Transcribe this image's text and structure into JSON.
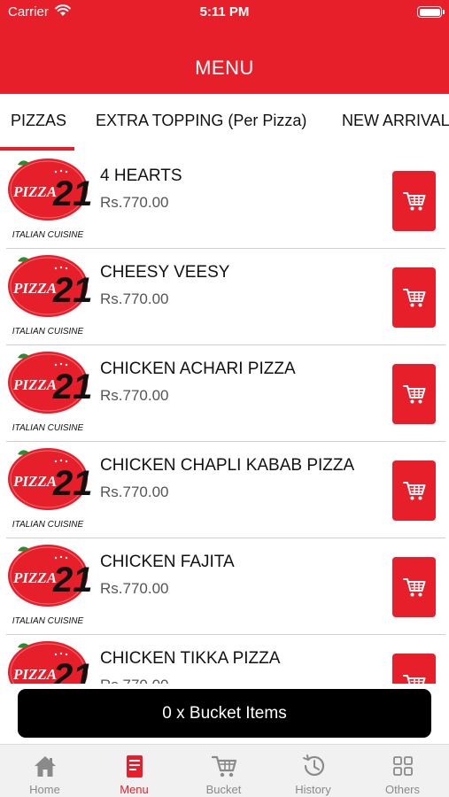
{
  "status_bar": {
    "carrier": "Carrier",
    "time": "5:11 PM"
  },
  "header": {
    "title": "MENU"
  },
  "tabs": [
    {
      "label": "PIZZAS",
      "active": true
    },
    {
      "label": "EXTRA TOPPING (Per Pizza)",
      "active": false
    },
    {
      "label": "NEW ARRIVAL",
      "active": false
    }
  ],
  "logo": {
    "brand": "PIZZA",
    "number": "21",
    "caption": "ITALIAN CUISINE"
  },
  "menu_items": [
    {
      "name": "4 HEARTS",
      "price": "Rs.770.00"
    },
    {
      "name": "CHEESY VEESY",
      "price": "Rs.770.00"
    },
    {
      "name": "CHICKEN ACHARI PIZZA",
      "price": "Rs.770.00"
    },
    {
      "name": "CHICKEN CHAPLI KABAB PIZZA",
      "price": "Rs.770.00"
    },
    {
      "name": "CHICKEN FAJITA",
      "price": "Rs.770.00"
    },
    {
      "name": "CHICKEN TIKKA PIZZA",
      "price": "Rs.770.00"
    }
  ],
  "bucket_bar": {
    "label": "0 x Bucket Items"
  },
  "bottom_nav": [
    {
      "label": "Home",
      "icon": "home-icon",
      "active": false
    },
    {
      "label": "Menu",
      "icon": "menu-icon",
      "active": true
    },
    {
      "label": "Bucket",
      "icon": "cart-icon",
      "active": false
    },
    {
      "label": "History",
      "icon": "history-icon",
      "active": false
    },
    {
      "label": "Others",
      "icon": "grid-icon",
      "active": false
    }
  ],
  "colors": {
    "brand_red": "#e61f2b",
    "bar_black": "#000000",
    "nav_inactive": "#8a8a8a"
  }
}
